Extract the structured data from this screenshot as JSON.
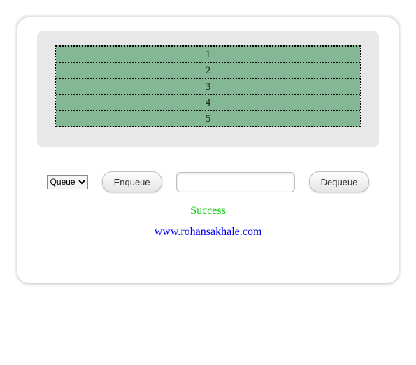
{
  "queue": {
    "items": [
      "1",
      "2",
      "3",
      "4",
      "5"
    ]
  },
  "controls": {
    "structure_options": [
      "Queue"
    ],
    "structure_selected": "Queue",
    "enqueue_label": "Enqueue",
    "dequeue_label": "Dequeue",
    "input_value": ""
  },
  "status": {
    "message": "Success"
  },
  "footer": {
    "link_text": "www.rohansakhale.com"
  }
}
